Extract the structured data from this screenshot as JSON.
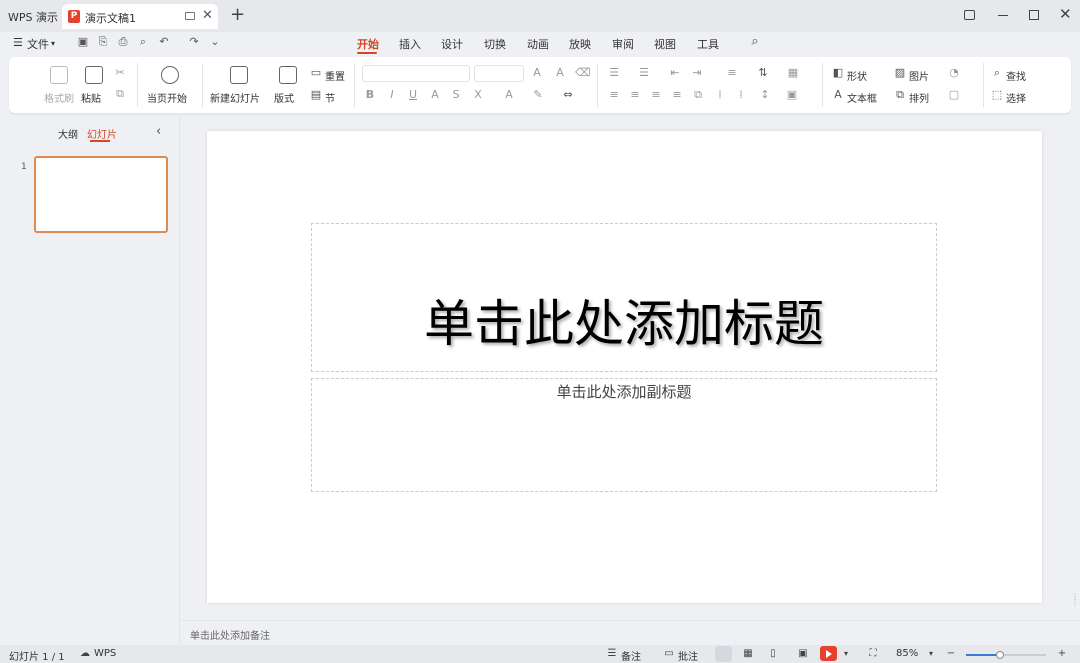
{
  "titlebar": {
    "app_name": "WPS 演示",
    "doc_name": "演示文稿1",
    "logo_letter": "P"
  },
  "menubar": {
    "file_label": "文件",
    "tabs": [
      "开始",
      "插入",
      "设计",
      "切换",
      "动画",
      "放映",
      "审阅",
      "视图",
      "工具"
    ],
    "active_tab": "开始"
  },
  "ribbon": {
    "format_painter": "格式刷",
    "paste": "粘贴",
    "from_current": "当页开始",
    "new_slide": "新建幻灯片",
    "layout": "版式",
    "reset": "重置",
    "section": "节",
    "shape": "形状",
    "picture": "图片",
    "textbox": "文本框",
    "arrange": "排列",
    "find": "查找",
    "select": "选择"
  },
  "left_panel": {
    "tab_outline": "大纲",
    "tab_slides": "幻灯片",
    "slide_number": "1"
  },
  "slide": {
    "title_placeholder": "单击此处添加标题",
    "subtitle_placeholder": "单击此处添加副标题"
  },
  "notes": {
    "placeholder": "单击此处添加备注"
  },
  "statusbar": {
    "slide_counter": "幻灯片 1 / 1",
    "wps_label": "WPS",
    "notes_label": "备注",
    "comments_label": "批注",
    "zoom": "85%",
    "zoom_fraction": 0.43
  },
  "colors": {
    "accent": "#d24726",
    "play": "#e4422c"
  }
}
